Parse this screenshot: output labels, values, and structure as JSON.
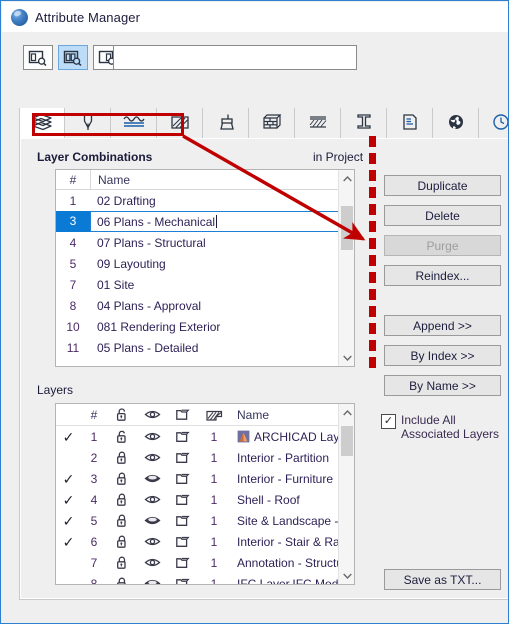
{
  "window": {
    "title": "Attribute Manager",
    "logo_icon": "archicad-logo-icon"
  },
  "toolbar": {
    "view_buttons": [
      {
        "name": "view-single-pane",
        "icon": "panel-search-left-icon",
        "selected": false
      },
      {
        "name": "view-dual-pane",
        "icon": "panel-search-dual-icon",
        "selected": true
      },
      {
        "name": "view-right-pane",
        "icon": "panel-search-right-icon",
        "selected": false
      }
    ],
    "search": {
      "value": "",
      "placeholder": ""
    }
  },
  "tabs": [
    {
      "label": "Layers",
      "icon": "layers-stack-icon",
      "active": true
    },
    {
      "label": "Pens",
      "icon": "pen-nib-icon",
      "active": false
    },
    {
      "label": "Line Types",
      "icon": "line-types-icon",
      "active": false
    },
    {
      "label": "Fill Types",
      "icon": "fill-hatch-icon",
      "active": false
    },
    {
      "label": "Surfaces",
      "icon": "paint-brush-icon",
      "active": false
    },
    {
      "label": "Building Materials",
      "icon": "brick-block-icon",
      "active": false
    },
    {
      "label": "Composites",
      "icon": "composite-layers-icon",
      "active": false
    },
    {
      "label": "Profiles",
      "icon": "i-beam-profile-icon",
      "active": false
    },
    {
      "label": "Zone Categories",
      "icon": "zone-doc-icon",
      "active": false
    },
    {
      "label": "Cities",
      "icon": "globe-icon",
      "active": false
    },
    {
      "label": "More",
      "icon": "clock-globe-icon",
      "active": false
    }
  ],
  "combinations": {
    "section_title": "Layer Combinations",
    "source_label": "in Project",
    "columns": {
      "num": "#",
      "name": "Name"
    },
    "rows": [
      {
        "num": "1",
        "name": "02 Drafting",
        "selected": false,
        "editing": false
      },
      {
        "num": "3",
        "name": "06 Plans - Mechanical",
        "selected": true,
        "editing": true
      },
      {
        "num": "4",
        "name": "07 Plans - Structural",
        "selected": false,
        "editing": false
      },
      {
        "num": "5",
        "name": "09 Layouting",
        "selected": false,
        "editing": false
      },
      {
        "num": "7",
        "name": "01 Site",
        "selected": false,
        "editing": false
      },
      {
        "num": "8",
        "name": "04 Plans - Approval",
        "selected": false,
        "editing": false
      },
      {
        "num": "10",
        "name": "081 Rendering Exterior",
        "selected": false,
        "editing": false
      },
      {
        "num": "11",
        "name": "05 Plans - Detailed",
        "selected": false,
        "editing": false
      }
    ],
    "scroll_up_icon": "chevron-up-icon",
    "scroll_down_icon": "chevron-down-icon"
  },
  "layers": {
    "section_title": "Layers",
    "columns": {
      "check": "",
      "num": "#",
      "lock": "lock-icon",
      "visibility": "eye-icon",
      "wireframe": "solid-wireframe-icon",
      "intersection": "intersection-hatch-icon",
      "name": "Name"
    },
    "rows": [
      {
        "checked": true,
        "num": "1",
        "lock": "unlocked",
        "eye": "open",
        "wire": "doc",
        "group": "1",
        "name": "ARCHICAD Layer",
        "badge": "archicad-layer-icon"
      },
      {
        "checked": false,
        "num": "2",
        "lock": "locked",
        "eye": "open",
        "wire": "doc",
        "group": "1",
        "name": "Interior - Partition",
        "badge": ""
      },
      {
        "checked": true,
        "num": "3",
        "lock": "locked",
        "eye": "closed",
        "wire": "doc",
        "group": "1",
        "name": "Interior - Furniture",
        "badge": ""
      },
      {
        "checked": true,
        "num": "4",
        "lock": "locked",
        "eye": "open",
        "wire": "doc",
        "group": "1",
        "name": "Shell - Roof",
        "badge": ""
      },
      {
        "checked": true,
        "num": "5",
        "lock": "locked",
        "eye": "closed",
        "wire": "doc",
        "group": "1",
        "name": "Site & Landscape - General",
        "badge": ""
      },
      {
        "checked": true,
        "num": "6",
        "lock": "locked",
        "eye": "open",
        "wire": "doc",
        "group": "1",
        "name": "Interior - Stair & Railing",
        "badge": ""
      },
      {
        "checked": false,
        "num": "7",
        "lock": "locked",
        "eye": "open",
        "wire": "doc",
        "group": "1",
        "name": "Annotation - Structure",
        "badge": ""
      },
      {
        "checked": false,
        "num": "8",
        "lock": "locked",
        "eye": "closed",
        "wire": "doc",
        "group": "1",
        "name": "IFC Layer.IFC Model",
        "badge": ""
      }
    ],
    "scroll_up_icon": "chevron-up-icon",
    "scroll_down_icon": "chevron-down-icon"
  },
  "actions": {
    "duplicate": "Duplicate",
    "delete": "Delete",
    "purge": "Purge",
    "purge_disabled": true,
    "reindex": "Reindex...",
    "append": "Append >>",
    "by_index": "By Index >>",
    "by_name": "By Name >>",
    "save_as_txt": "Save as TXT...",
    "include_all_line1": "Include All",
    "include_all_line2": "Associated Layers",
    "include_all_checked": true
  },
  "annotation": {
    "highlight_color": "#c00000",
    "box_target": "Layer Combinations",
    "arrow_target": "Reindex..."
  }
}
